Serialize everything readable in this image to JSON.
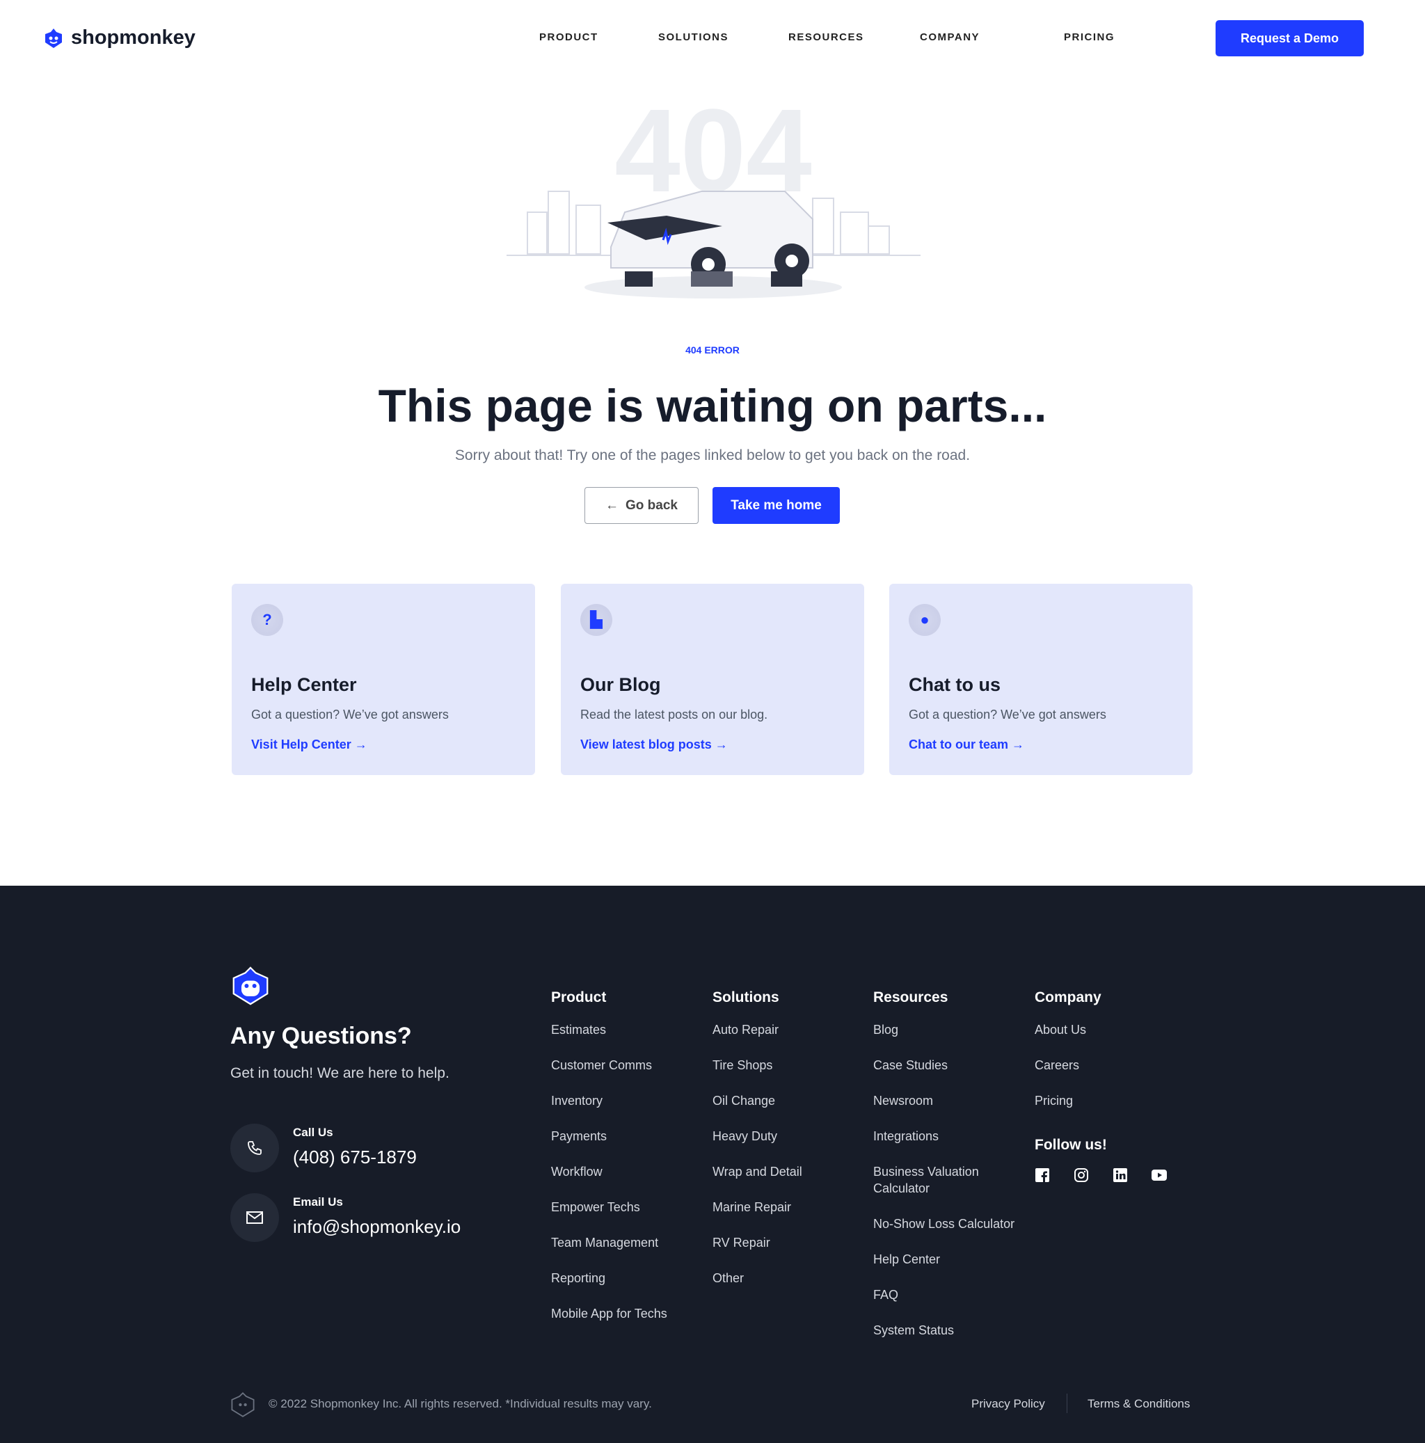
{
  "header": {
    "brand": "shopmonkey",
    "nav": [
      "PRODUCT",
      "SOLUTIONS",
      "RESOURCES",
      "COMPANY",
      "PRICING"
    ],
    "cta": "Request a Demo"
  },
  "hero": {
    "illustration_text": "404",
    "eyebrow": "404 ERROR",
    "title": "This page is waiting on parts...",
    "subtitle": "Sorry about that! Try one of the pages linked below to get you back on the road.",
    "back_label": "Go back",
    "home_label": "Take me home"
  },
  "cards": [
    {
      "icon": "question-icon",
      "title": "Help Center",
      "text": "Got a question? We’ve got answers",
      "link": "Visit Help Center"
    },
    {
      "icon": "blog-icon",
      "title": "Our Blog",
      "text": "Read the latest posts on our blog.",
      "link": "View latest blog posts"
    },
    {
      "icon": "chat-icon",
      "title": "Chat to us",
      "text": "Got a question? We’ve got answers",
      "link": "Chat to our team"
    }
  ],
  "footer": {
    "title": "Any Questions?",
    "subtitle": "Get in touch!  We are here to help.",
    "call_label": "Call Us",
    "phone": "(408) 675-1879",
    "email_label": "Email Us",
    "email": "info@shopmonkey.io",
    "columns": [
      {
        "title": "Product",
        "items": [
          "Estimates",
          "Customer Comms",
          "Inventory",
          "Payments",
          "Workflow",
          "Empower Techs",
          "Team Management",
          "Reporting",
          "Mobile App for Techs"
        ]
      },
      {
        "title": "Solutions",
        "items": [
          "Auto Repair",
          "Tire Shops",
          "Oil Change",
          "Heavy Duty",
          "Wrap and Detail",
          "Marine Repair",
          "RV Repair",
          "Other"
        ]
      },
      {
        "title": "Resources",
        "items": [
          "Blog",
          "Case Studies",
          "Newsroom",
          "Integrations",
          "Business Valuation Calculator",
          "No-Show Loss Calculator",
          "Help Center",
          "FAQ",
          "System Status"
        ]
      },
      {
        "title": "Company",
        "items": [
          "About Us",
          "Careers",
          "Pricing"
        ]
      }
    ],
    "follow": "Follow us!",
    "social": [
      "facebook-icon",
      "instagram-icon",
      "linkedin-icon",
      "youtube-icon"
    ],
    "copyright": "© 2022 Shopmonkey Inc. All rights reserved. *Individual results may vary.",
    "privacy": "Privacy Policy",
    "terms": "Terms & Conditions"
  },
  "colors": {
    "accent": "#1f3cff",
    "footer_bg": "#171c28",
    "card_bg": "#e3e7fb"
  }
}
